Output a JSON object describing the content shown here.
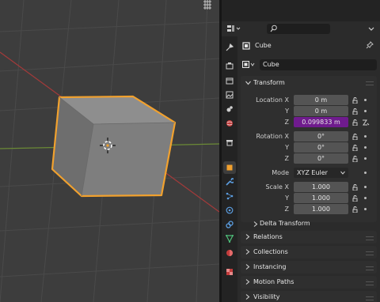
{
  "header": {
    "search_placeholder": "",
    "editor_icon": "properties-editor-icon"
  },
  "object": {
    "name": "Cube",
    "data_name": "Cube"
  },
  "transform": {
    "title": "Transform",
    "location": {
      "label_x": "Location X",
      "label_y": "Y",
      "label_z": "Z",
      "x": "0 m",
      "y": "0 m",
      "z": "0.099833 m"
    },
    "rotation": {
      "label_x": "Rotation X",
      "label_y": "Y",
      "label_z": "Z",
      "x": "0°",
      "y": "0°",
      "z": "0°"
    },
    "mode": {
      "label": "Mode",
      "value": "XYZ Euler"
    },
    "scale": {
      "label_x": "Scale X",
      "label_y": "Y",
      "label_z": "Z",
      "x": "1.000",
      "y": "1.000",
      "z": "1.000"
    },
    "delta": "Delta Transform"
  },
  "panels": [
    "Relations",
    "Collections",
    "Instancing",
    "Motion Paths",
    "Visibility"
  ],
  "tabs": [
    "tool",
    "render",
    "output",
    "view-layer",
    "scene",
    "world",
    "collection",
    "object",
    "modifiers",
    "particles",
    "physics",
    "constraints",
    "data",
    "material",
    "texture"
  ],
  "colors": {
    "accent_purple": "#6f1b8e",
    "selection_orange": "#f1a12e",
    "x_axis": "#b83a3a",
    "y_axis": "#7ca932"
  }
}
